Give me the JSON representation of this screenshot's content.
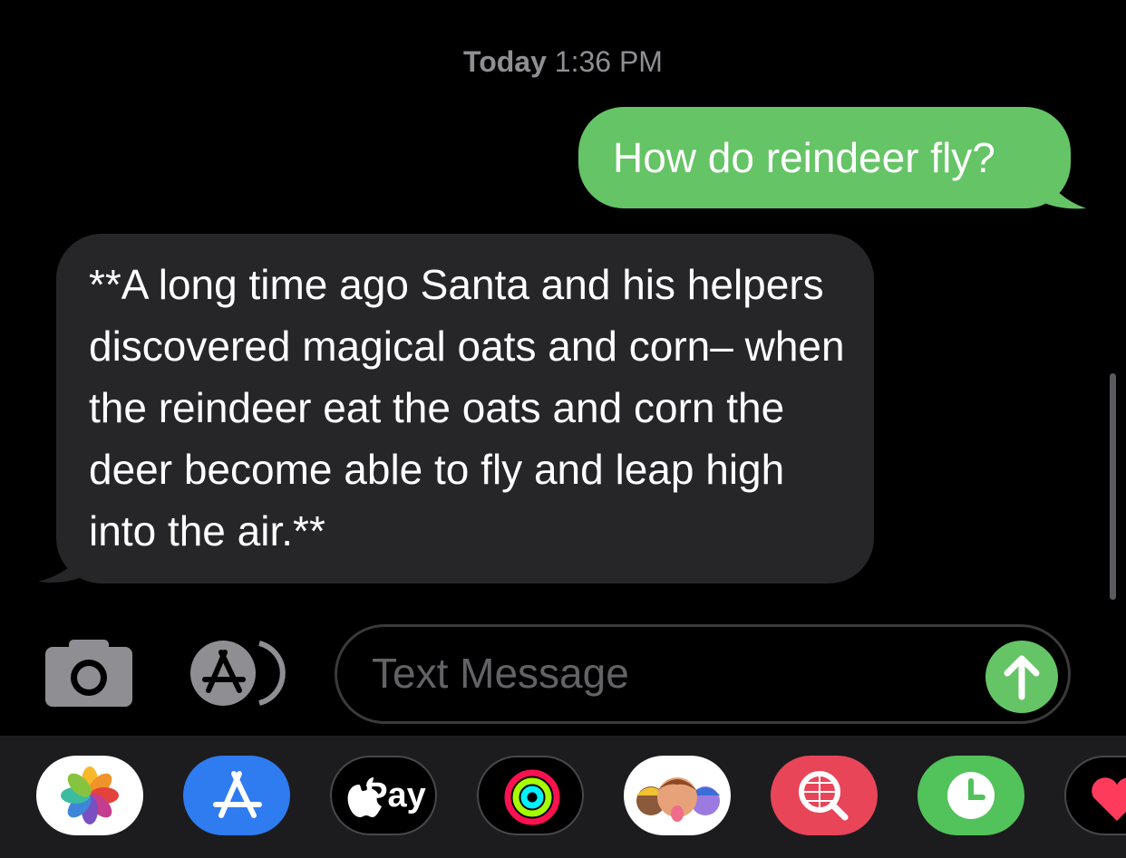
{
  "header": {
    "day": "Today",
    "time": "1:36 PM"
  },
  "messages": [
    {
      "direction": "outgoing",
      "text": "How do reindeer fly?"
    },
    {
      "direction": "incoming",
      "text": "**A long time ago Santa and his helpers discovered magical oats and corn– when the reindeer eat the oats and corn the deer become able to fly and leap high into the air.**"
    }
  ],
  "compose": {
    "placeholder": "Text Message",
    "camera_icon": "camera-icon",
    "apps_icon": "app-store-icon",
    "send_icon": "arrow-up-icon"
  },
  "app_drawer": {
    "items": [
      {
        "name": "photos",
        "icon": "photos-icon"
      },
      {
        "name": "app-store",
        "icon": "app-store-icon"
      },
      {
        "name": "apple-pay",
        "icon": "apple-icon",
        "label": "Pay"
      },
      {
        "name": "activity",
        "icon": "activity-rings-icon"
      },
      {
        "name": "memoji",
        "icon": "memoji-icon"
      },
      {
        "name": "images-search",
        "icon": "globe-search-icon"
      },
      {
        "name": "clock",
        "icon": "clock-icon"
      },
      {
        "name": "digital-touch",
        "icon": "heart-icon"
      }
    ]
  },
  "colors": {
    "background": "#000000",
    "outgoing_bubble": "#65c466",
    "incoming_bubble": "#262628",
    "timestamp": "#8e8e93",
    "placeholder": "#636366",
    "drawer": "#1c1c1e"
  }
}
